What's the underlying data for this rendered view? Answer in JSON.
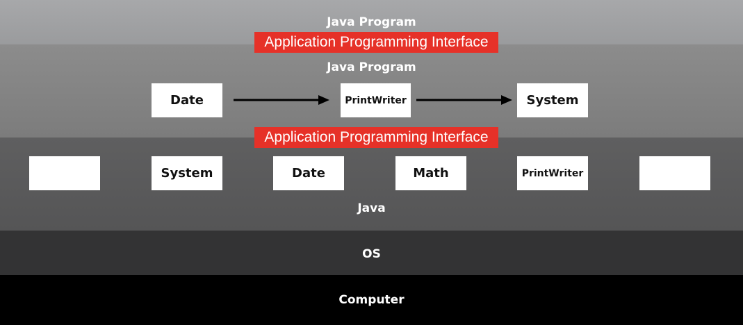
{
  "layers": {
    "top_program": "Java Program",
    "api_top": "Application Programming Interface",
    "program": "Java Program",
    "api_bottom": "Application Programming Interface",
    "java": "Java",
    "os": "OS",
    "computer": "Computer"
  },
  "program_flow": [
    "Date",
    "PrintWriter",
    "System"
  ],
  "java_classes": [
    "",
    "System",
    "Date",
    "Math",
    "PrintWriter",
    ""
  ],
  "colors": {
    "api_highlight": "#e63128",
    "box": "#ffffff",
    "arrow": "#000000"
  }
}
